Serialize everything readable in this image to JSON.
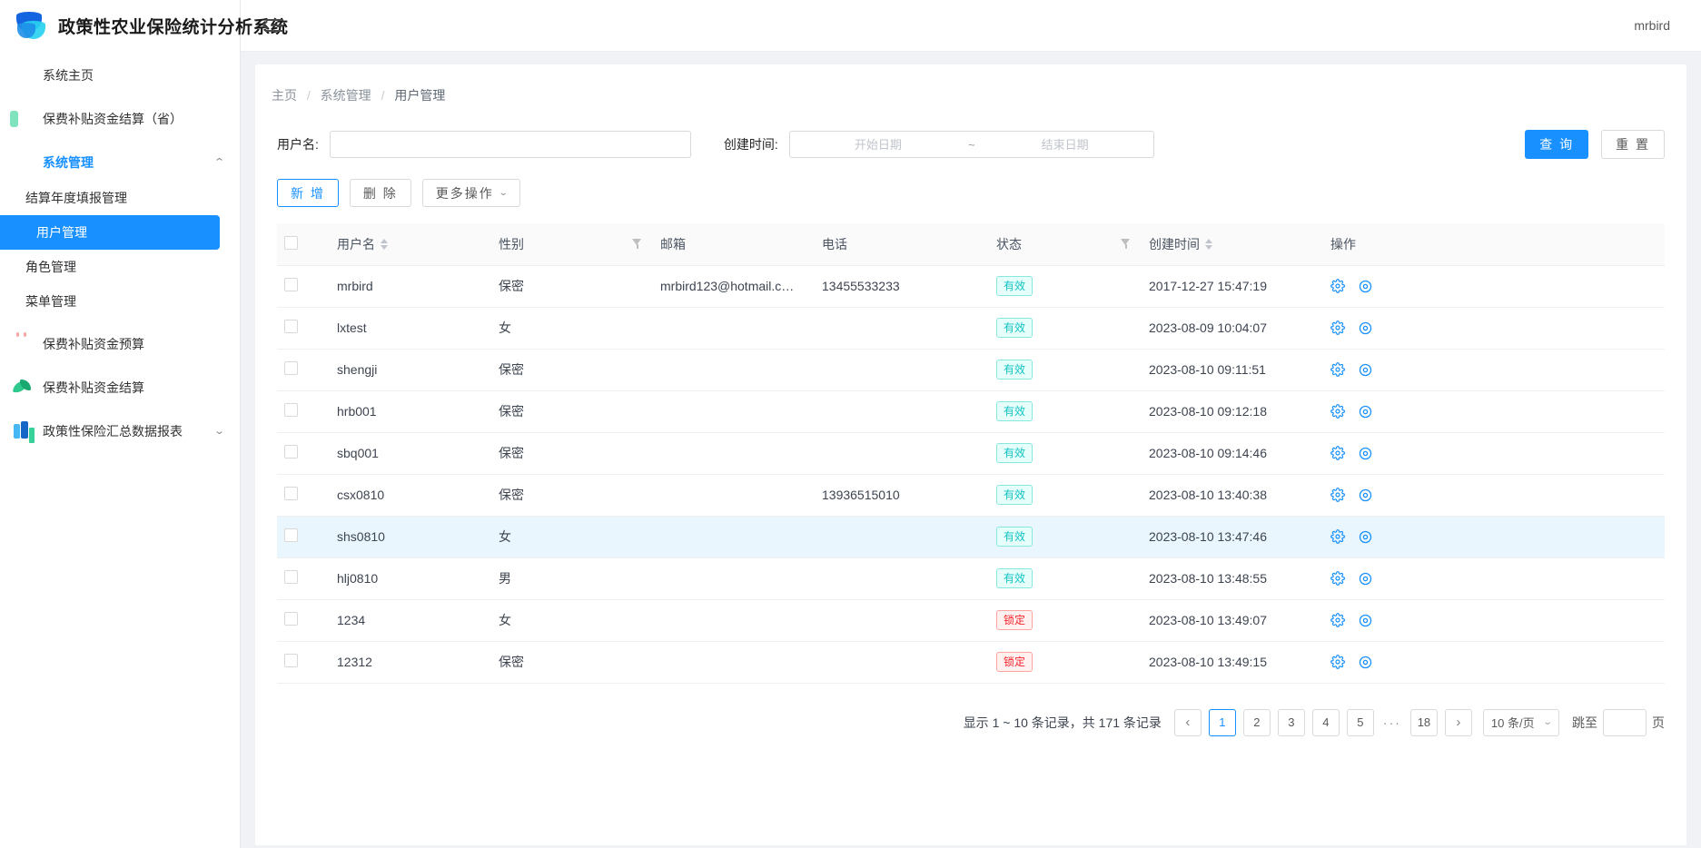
{
  "brand": {
    "title": "政策性农业保险统计分析系统",
    "logo_icon": "layered-disc-logo"
  },
  "sidebar": {
    "items": [
      {
        "label": "系统主页",
        "icon": "home-icon",
        "type": "link"
      },
      {
        "label": "保费补贴资金结算（省）",
        "icon": "green-plus-icon",
        "type": "link"
      },
      {
        "label": "系统管理",
        "icon": "shield-list-icon",
        "type": "group",
        "expanded": true,
        "arrow": "⌃"
      },
      {
        "label": "结算年度填报管理",
        "type": "sub"
      },
      {
        "label": "用户管理",
        "type": "sub",
        "selected": true
      },
      {
        "label": "角色管理",
        "type": "sub"
      },
      {
        "label": "菜单管理",
        "type": "sub"
      },
      {
        "label": "保费补贴资金预算",
        "icon": "red-note-icon",
        "type": "link"
      },
      {
        "label": "保费补贴资金结算",
        "icon": "green-leaf-icon",
        "type": "link"
      },
      {
        "label": "政策性保险汇总数据报表",
        "icon": "bar-chart-icon",
        "type": "group",
        "expanded": false,
        "arrow": "⌄"
      }
    ]
  },
  "topbar": {
    "collapse_icon": "menu-fold-icon",
    "user": "mrbird"
  },
  "breadcrumb": {
    "items": [
      "主页",
      "系统管理",
      "用户管理"
    ],
    "separator": "/"
  },
  "filters": {
    "username_label": "用户名:",
    "username_value": "",
    "username_placeholder": "",
    "create_time_label": "创建时间:",
    "start_placeholder": "开始日期",
    "end_placeholder": "结束日期",
    "range_separator": "~",
    "query_button": "查 询",
    "reset_button": "重 置"
  },
  "toolbar": {
    "add_label": "新 增",
    "delete_label": "删 除",
    "more_label": "更多操作",
    "more_caret": "⌄"
  },
  "table": {
    "columns": [
      {
        "label": "",
        "key": "checkbox"
      },
      {
        "label": "用户名",
        "key": "username",
        "sortable": true
      },
      {
        "label": "性别",
        "key": "gender",
        "filterable": true
      },
      {
        "label": "邮箱",
        "key": "email"
      },
      {
        "label": "电话",
        "key": "phone"
      },
      {
        "label": "状态",
        "key": "status",
        "filterable": true
      },
      {
        "label": "创建时间",
        "key": "created",
        "sortable": true
      },
      {
        "label": "操作",
        "key": "ops"
      }
    ],
    "rows": [
      {
        "username": "mrbird",
        "gender": "保密",
        "email": "mrbird123@hotmail.c…",
        "phone": "13455533233",
        "status": "有效",
        "status_type": "valid",
        "created": "2017-12-27 15:47:19",
        "highlighted": false
      },
      {
        "username": "lxtest",
        "gender": "女",
        "email": "",
        "phone": "",
        "status": "有效",
        "status_type": "valid",
        "created": "2023-08-09 10:04:07",
        "highlighted": false
      },
      {
        "username": "shengji",
        "gender": "保密",
        "email": "",
        "phone": "",
        "status": "有效",
        "status_type": "valid",
        "created": "2023-08-10 09:11:51",
        "highlighted": false
      },
      {
        "username": "hrb001",
        "gender": "保密",
        "email": "",
        "phone": "",
        "status": "有效",
        "status_type": "valid",
        "created": "2023-08-10 09:12:18",
        "highlighted": false
      },
      {
        "username": "sbq001",
        "gender": "保密",
        "email": "",
        "phone": "",
        "status": "有效",
        "status_type": "valid",
        "created": "2023-08-10 09:14:46",
        "highlighted": false
      },
      {
        "username": "csx0810",
        "gender": "保密",
        "email": "",
        "phone": "13936515010",
        "status": "有效",
        "status_type": "valid",
        "created": "2023-08-10 13:40:38",
        "highlighted": false
      },
      {
        "username": "shs0810",
        "gender": "女",
        "email": "",
        "phone": "",
        "status": "有效",
        "status_type": "valid",
        "created": "2023-08-10 13:47:46",
        "highlighted": true
      },
      {
        "username": "hlj0810",
        "gender": "男",
        "email": "",
        "phone": "",
        "status": "有效",
        "status_type": "valid",
        "created": "2023-08-10 13:48:55",
        "highlighted": false
      },
      {
        "username": "1234",
        "gender": "女",
        "email": "",
        "phone": "",
        "status": "锁定",
        "status_type": "locked",
        "created": "2023-08-10 13:49:07",
        "highlighted": false
      },
      {
        "username": "12312",
        "gender": "保密",
        "email": "",
        "phone": "",
        "status": "锁定",
        "status_type": "locked",
        "created": "2023-08-10 13:49:15",
        "highlighted": false
      }
    ],
    "row_ops": [
      {
        "icon": "gear-icon",
        "name": "edit-settings"
      },
      {
        "icon": "eye-icon",
        "name": "view-detail"
      }
    ]
  },
  "pagination": {
    "summary": "显示 1 ~ 10 条记录，共 171 条记录",
    "prev_icon": "‹",
    "next_icon": "›",
    "pages": [
      "1",
      "2",
      "3",
      "4",
      "5"
    ],
    "ellipsis": "···",
    "last_page": "18",
    "current_page": "1",
    "page_size_label": "10 条/页",
    "page_size_caret": "⌄",
    "jump_label": "跳至",
    "jump_value": "",
    "jump_suffix": "页"
  },
  "colors": {
    "primary": "#1890ff",
    "valid_tag": "#13c2c2",
    "locked_tag": "#f5222d",
    "row_highlight": "#e9f6fe"
  }
}
